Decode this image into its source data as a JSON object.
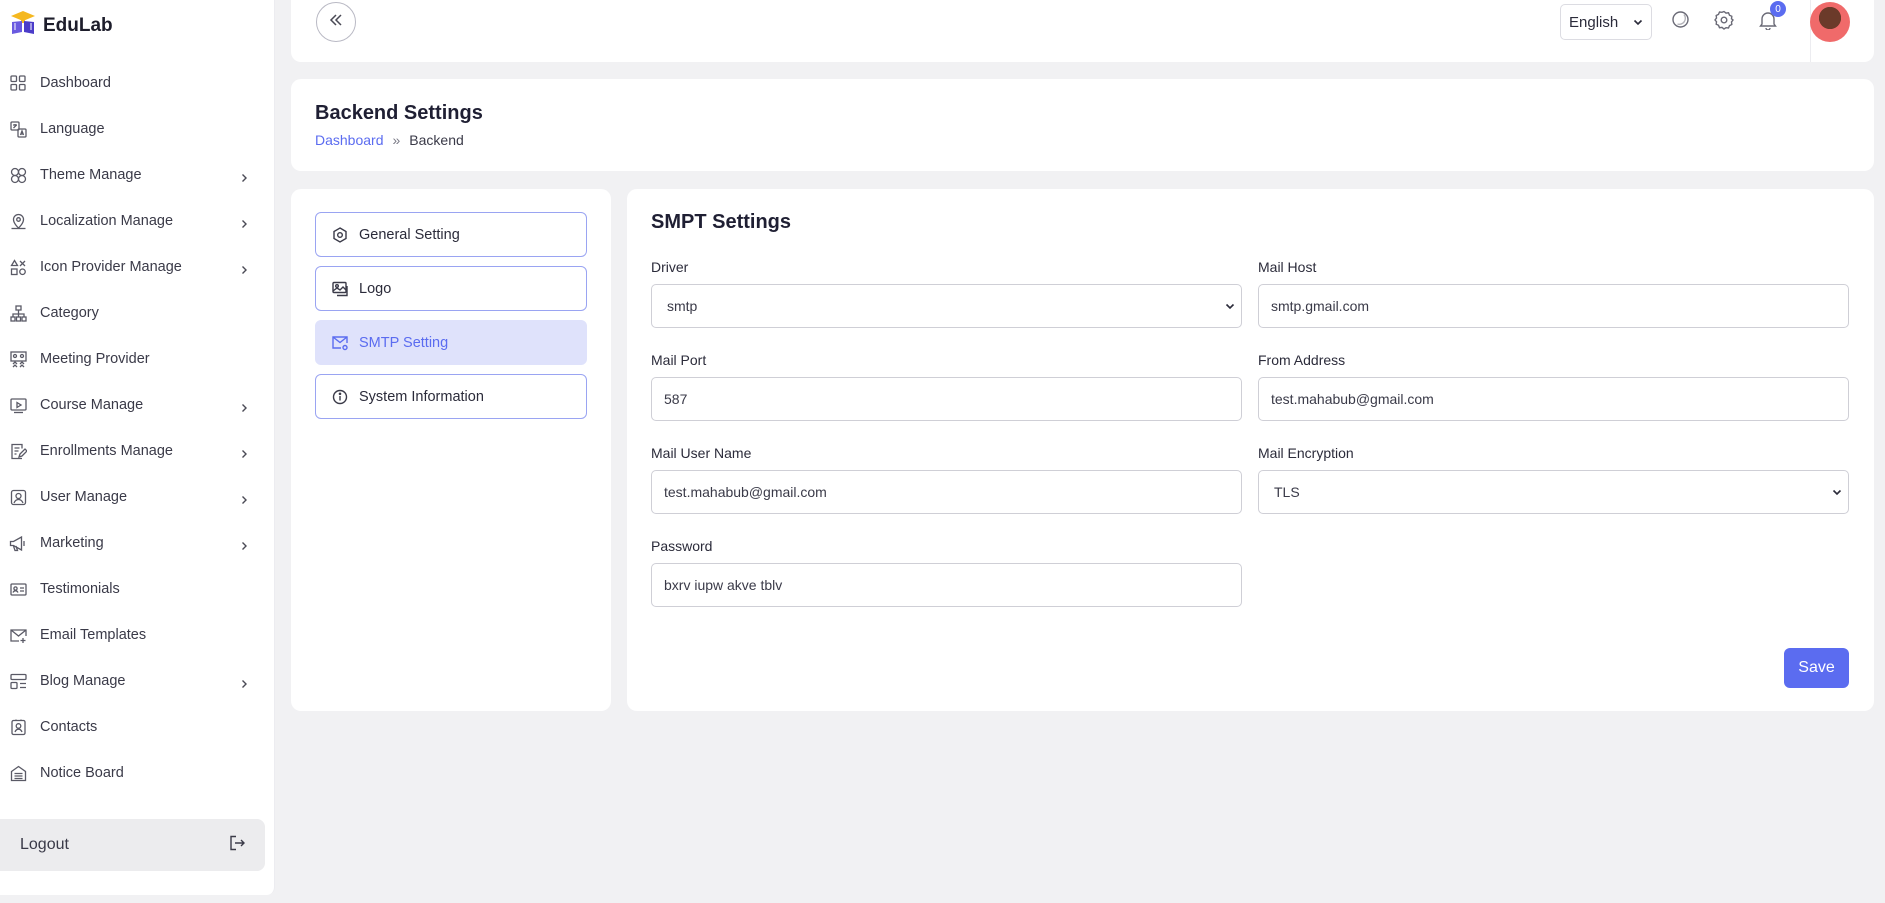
{
  "app": {
    "name": "EduLab"
  },
  "sidebar": {
    "items": [
      {
        "label": "Dashboard",
        "icon": "grid-icon",
        "has_submenu": false
      },
      {
        "label": "Language",
        "icon": "translate-icon",
        "has_submenu": false
      },
      {
        "label": "Theme Manage",
        "icon": "palette-icon",
        "has_submenu": true
      },
      {
        "label": "Localization Manage",
        "icon": "map-pin-icon",
        "has_submenu": true
      },
      {
        "label": "Icon Provider Manage",
        "icon": "shapes-icon",
        "has_submenu": true
      },
      {
        "label": "Category",
        "icon": "hierarchy-icon",
        "has_submenu": false
      },
      {
        "label": "Meeting Provider",
        "icon": "meeting-icon",
        "has_submenu": false
      },
      {
        "label": "Course Manage",
        "icon": "video-play-icon",
        "has_submenu": true
      },
      {
        "label": "Enrollments Manage",
        "icon": "edit-note-icon",
        "has_submenu": true
      },
      {
        "label": "User Manage",
        "icon": "user-icon",
        "has_submenu": true
      },
      {
        "label": "Marketing",
        "icon": "megaphone-icon",
        "has_submenu": true
      },
      {
        "label": "Testimonials",
        "icon": "id-card-icon",
        "has_submenu": false
      },
      {
        "label": "Email Templates",
        "icon": "mail-plus-icon",
        "has_submenu": false
      },
      {
        "label": "Blog Manage",
        "icon": "blog-icon",
        "has_submenu": true
      },
      {
        "label": "Contacts",
        "icon": "contact-icon",
        "has_submenu": false
      },
      {
        "label": "Notice Board",
        "icon": "notice-icon",
        "has_submenu": false
      }
    ],
    "logout_label": "Logout"
  },
  "topbar": {
    "language": "English",
    "notification_count": "0"
  },
  "page": {
    "title": "Backend Settings",
    "breadcrumb": {
      "home": "Dashboard",
      "separator": "»",
      "current": "Backend"
    }
  },
  "settings_menu": {
    "items": [
      {
        "label": "General Setting",
        "icon": "settings-hex-icon",
        "active": false
      },
      {
        "label": "Logo",
        "icon": "image-icon",
        "active": false
      },
      {
        "label": "SMTP Setting",
        "icon": "mail-settings-icon",
        "active": true
      },
      {
        "label": "System Information",
        "icon": "info-icon",
        "active": false
      }
    ]
  },
  "smtp_form": {
    "title": "SMPT Settings",
    "driver": {
      "label": "Driver",
      "value": "smtp"
    },
    "mail_host": {
      "label": "Mail Host",
      "value": "smtp.gmail.com"
    },
    "mail_port": {
      "label": "Mail Port",
      "value": "587"
    },
    "from_address": {
      "label": "From Address",
      "value": "test.mahabub@gmail.com"
    },
    "mail_user_name": {
      "label": "Mail User Name",
      "value": "test.mahabub@gmail.com"
    },
    "mail_encryption": {
      "label": "Mail Encryption",
      "value": "TLS"
    },
    "password": {
      "label": "Password",
      "value": "bxrv iupw akve tblv"
    },
    "save_label": "Save"
  },
  "colors": {
    "accent": "#5b6cf0",
    "active_bg": "#dfe2fb",
    "page_bg": "#f1f1f3"
  }
}
